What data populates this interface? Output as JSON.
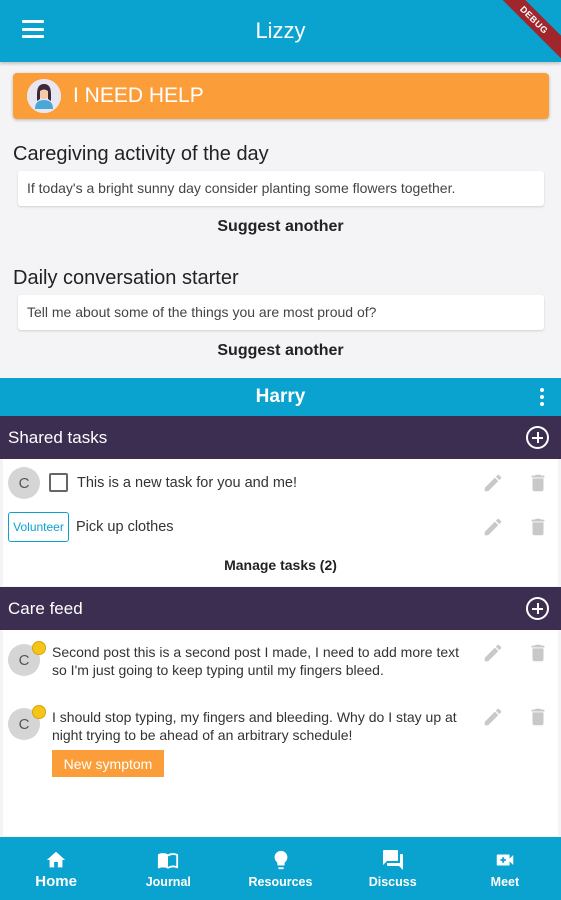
{
  "app": {
    "title": "Lizzy",
    "debug_label": "DEBUG"
  },
  "help_button": {
    "label": "I NEED HELP"
  },
  "activity": {
    "title": "Caregiving activity of the day",
    "text": "If today's a bright sunny day consider planting some flowers together.",
    "suggest_label": "Suggest another"
  },
  "conversation": {
    "title": "Daily conversation starter",
    "text": "Tell me about some of the things you are most proud of?",
    "suggest_label": "Suggest another"
  },
  "person": {
    "name": "Harry"
  },
  "shared_tasks": {
    "title": "Shared tasks",
    "tasks": [
      {
        "avatar": "C",
        "text": "This is a new task for you and me!"
      },
      {
        "volunteer_label": "Volunteer",
        "text": "Pick up clothes"
      }
    ],
    "manage_label": "Manage tasks (2)"
  },
  "care_feed": {
    "title": "Care feed",
    "posts": [
      {
        "avatar": "C",
        "text": "Second post this is a second post I made, I need to add more text so I'm just going to keep typing until my fingers bleed."
      },
      {
        "avatar": "C",
        "text": "I should stop typing, my fingers and bleeding. Why do I stay up at night trying to be ahead of an arbitrary schedule!",
        "tag": "New symptom"
      }
    ]
  },
  "bottom_nav": [
    {
      "label": "Home",
      "icon": "home-icon"
    },
    {
      "label": "Journal",
      "icon": "book-icon"
    },
    {
      "label": "Resources",
      "icon": "lightbulb-icon"
    },
    {
      "label": "Discuss",
      "icon": "chat-icon"
    },
    {
      "label": "Meet",
      "icon": "video-icon"
    }
  ],
  "colors": {
    "primary": "#0aa2cf",
    "accent": "#fb9e3a",
    "dark": "#3c2e50"
  }
}
